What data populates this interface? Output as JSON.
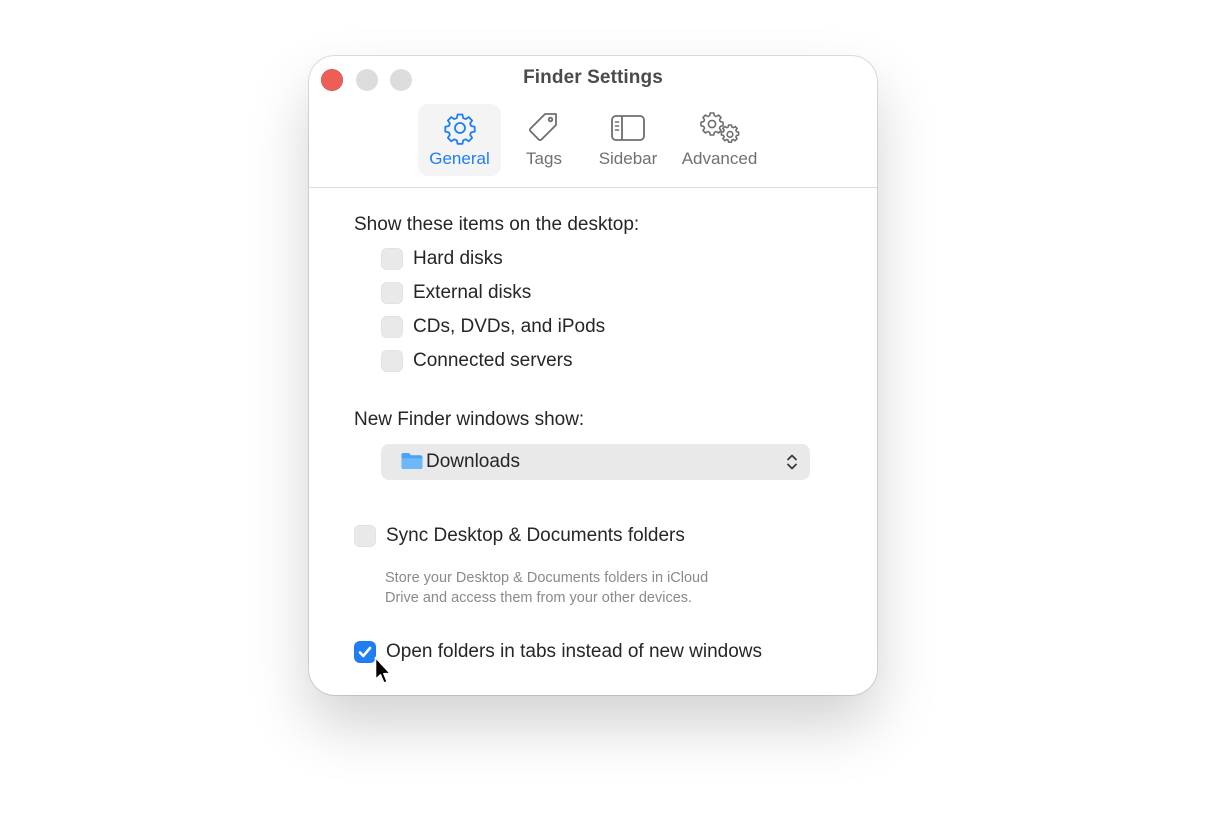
{
  "window": {
    "title": "Finder Settings"
  },
  "tabs": [
    {
      "label": "General",
      "icon": "gear-icon",
      "selected": true
    },
    {
      "label": "Tags",
      "icon": "tag-icon",
      "selected": false
    },
    {
      "label": "Sidebar",
      "icon": "sidebar-icon",
      "selected": false
    },
    {
      "label": "Advanced",
      "icon": "gears-icon",
      "selected": false
    }
  ],
  "desktop": {
    "heading": "Show these items on the desktop:",
    "items": [
      {
        "label": "Hard disks",
        "checked": false
      },
      {
        "label": "External disks",
        "checked": false
      },
      {
        "label": "CDs, DVDs, and iPods",
        "checked": false
      },
      {
        "label": "Connected servers",
        "checked": false
      }
    ]
  },
  "new_windows": {
    "heading": "New Finder windows show:",
    "selected": "Downloads"
  },
  "sync": {
    "label": "Sync Desktop & Documents folders",
    "checked": false,
    "help_line1": "Store your Desktop & Documents folders in iCloud",
    "help_line2": "Drive and access them from your other devices."
  },
  "tabs_option": {
    "label": "Open folders in tabs instead of new windows",
    "checked": true
  },
  "colors": {
    "accent": "#1f7ef2",
    "close": "#ed5e57",
    "inactive_light": "#dcdcdc",
    "checkbox_off": "#e9e9e9"
  }
}
